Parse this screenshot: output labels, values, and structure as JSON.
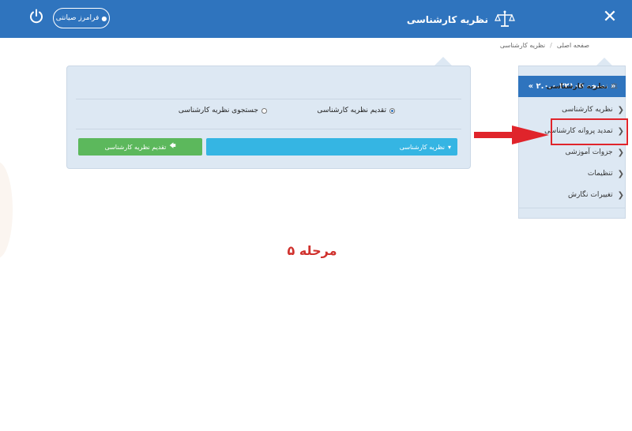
{
  "header": {
    "title": "نظریه کارشناسی",
    "user_label": "فرامرز صیانتی",
    "close_glyph": "✕"
  },
  "breadcrumb": {
    "home": "صفحه اصلی",
    "separator": "/",
    "current": "نظریه کارشناسی"
  },
  "sidebar": {
    "version": "« نسخه ۲.۰.۰.۲۲۱۰۵ »",
    "items": [
      {
        "label": "نظریه کارشناسی"
      },
      {
        "label": "تمدید پروانه کارشناسی"
      },
      {
        "label": "جزوات آموزشی"
      },
      {
        "label": "تنظیمات"
      },
      {
        "label": "تغییرات نگارش"
      }
    ]
  },
  "panel": {
    "title": "نظریه کارشناسی",
    "radio_submit": "تقدیم نظریه کارشناسی",
    "radio_search": "جستجوی نظریه کارشناسی",
    "select_label": "نظریه کارشناسی",
    "submit_button": "تقدیم نظریه کارشناسی"
  },
  "annotation": {
    "step": "مرحله ۵"
  },
  "colors": {
    "header_blue": "#2f74be",
    "panel_bg": "#dde8f3",
    "select_blue": "#35b5e3",
    "submit_green": "#5cb85c",
    "annotation_red": "#e0242b"
  }
}
